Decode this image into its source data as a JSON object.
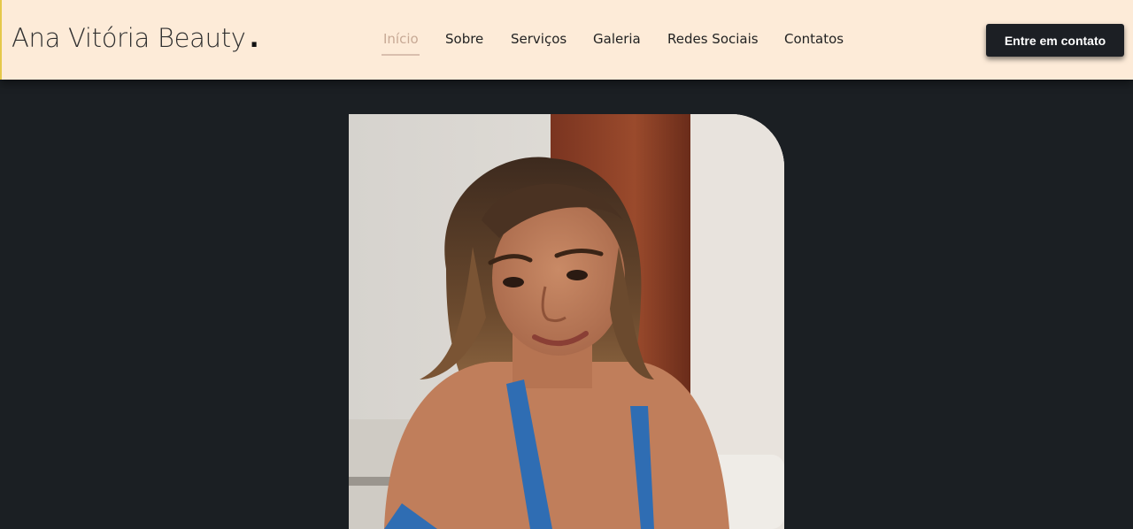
{
  "brand": {
    "name": "Ana Vitória Beauty",
    "dot": "."
  },
  "nav": {
    "items": [
      {
        "label": "Início",
        "active": true
      },
      {
        "label": "Sobre",
        "active": false
      },
      {
        "label": "Serviços",
        "active": false
      },
      {
        "label": "Galeria",
        "active": false
      },
      {
        "label": "Redes Sociais",
        "active": false
      },
      {
        "label": "Contatos",
        "active": false
      }
    ]
  },
  "cta": {
    "label": "Entre em contato"
  },
  "colors": {
    "header_bg": "#fdebd8",
    "page_bg": "#1b1f23",
    "button_bg": "#1c1f24",
    "active_nav": "#c7a995"
  },
  "hero": {
    "image": "portrait-photo"
  }
}
